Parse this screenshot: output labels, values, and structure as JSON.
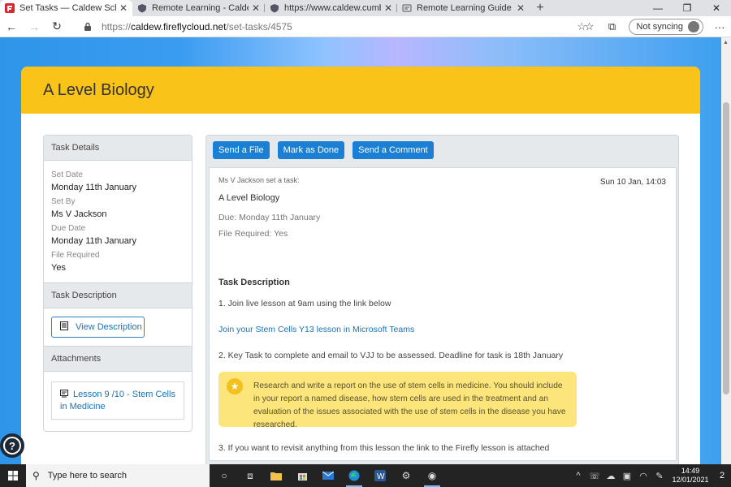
{
  "browser": {
    "tabs": [
      {
        "title": "Set Tasks — Caldew School",
        "active": true
      },
      {
        "title": "Remote Learning - Caldew School",
        "active": false
      },
      {
        "title": "https://www.caldew.cumbria.sch",
        "active": false
      },
      {
        "title": "Remote Learning Guide & IT Sup",
        "active": false
      }
    ],
    "url_scheme": "https://",
    "url_host": "caldew.fireflycloud.net",
    "url_path": "/set-tasks/4575",
    "sync_label": "Not syncing"
  },
  "page": {
    "title": "A Level Biology",
    "sidebar": {
      "details_heading": "Task Details",
      "fields": [
        {
          "label": "Set Date",
          "value": "Monday 11th January"
        },
        {
          "label": "Set By",
          "value": "Ms V Jackson"
        },
        {
          "label": "Due Date",
          "value": "Monday 11th January"
        },
        {
          "label": "File Required",
          "value": "Yes"
        }
      ],
      "description_heading": "Task Description",
      "view_description_label": "View Description",
      "attachments_heading": "Attachments",
      "attachment_label": "Lesson 9 /10 - Stem Cells in Medicine"
    },
    "toolbar": {
      "send_file": "Send a File",
      "mark_done": "Mark as Done",
      "send_comment": "Send a Comment"
    },
    "message": {
      "from": "Ms V Jackson set a task:",
      "timestamp": "Sun 10 Jan, 14:03",
      "subject": "A Level Biology",
      "due": "Due: Monday 11th January",
      "file_required": "File Required: Yes",
      "description_heading": "Task Description",
      "step1": "1. Join live lesson at 9am using the link below",
      "teams_link": "Join your Stem Cells Y13 lesson in Microsoft Teams",
      "step2": "2. Key Task to complete and email to VJJ to be assessed. Deadline for task is 18th January",
      "callout": "Research and write a report on the use of stem cells in medicine. You should include in your report a named disease, how stem cells are used in the treatment and an evaluation of the issues associated with the use of stem cells in the disease you have researched.",
      "step3": "3. If you want to revisit anything from this lesson the link to the Firefly lesson is attached"
    },
    "colors": {
      "header_yellow": "#fac31a",
      "primary_blue": "#1b7fd4",
      "callout_yellow": "#fce57a"
    }
  },
  "taskbar": {
    "search_placeholder": "Type here to search",
    "time": "14:49",
    "date": "12/01/2021",
    "notification_count": "2"
  }
}
